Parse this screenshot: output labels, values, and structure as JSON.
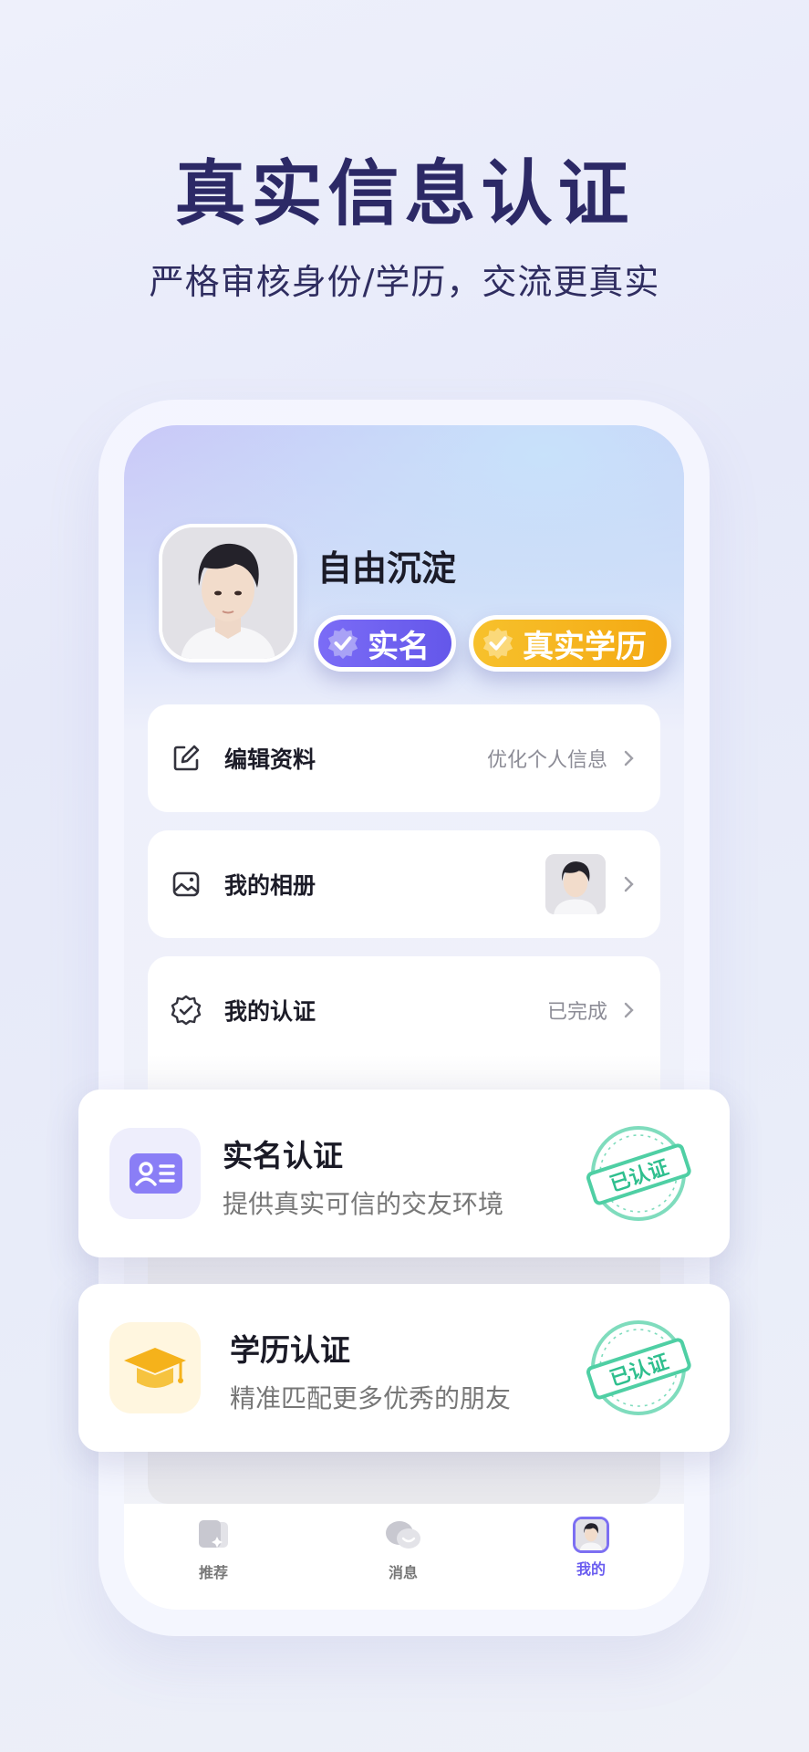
{
  "hero": {
    "title": "真实信息认证",
    "subtitle": "严格审核身份/学历，交流更真实"
  },
  "profile": {
    "nickname": "自由沉淀",
    "badges": [
      {
        "label": "实名",
        "color": "#6a5cf0",
        "icon": "verified-seal-icon"
      },
      {
        "label": "真实学历",
        "color": "#f5b21b",
        "icon": "verified-seal-icon"
      }
    ]
  },
  "menu": [
    {
      "label": "编辑资料",
      "hint": "优化个人信息",
      "icon": "edit-icon"
    },
    {
      "label": "我的相册",
      "hint": "",
      "icon": "album-icon"
    },
    {
      "label": "我的认证",
      "hint": "已完成",
      "icon": "verified-icon"
    }
  ],
  "overlays": [
    {
      "title": "实名认证",
      "subtitle": "提供真实可信的交友环境",
      "icon": "id-card-icon",
      "stamp": "已认证",
      "icon_bg": "#eeeefc"
    },
    {
      "title": "学历认证",
      "subtitle": "精准匹配更多优秀的朋友",
      "icon": "graduation-cap-icon",
      "stamp": "已认证",
      "icon_bg": "#fff6df"
    }
  ],
  "tabbar": [
    {
      "label": "推荐",
      "icon": "cards-icon",
      "active": false
    },
    {
      "label": "消息",
      "icon": "chat-bubble-icon",
      "active": false
    },
    {
      "label": "我的",
      "icon": "avatar-tab-icon",
      "active": true
    }
  ],
  "colors": {
    "accent": "#6a5cf0",
    "gold": "#f5b21b",
    "stamp": "#5ed0ac",
    "headline": "#2c2966"
  }
}
